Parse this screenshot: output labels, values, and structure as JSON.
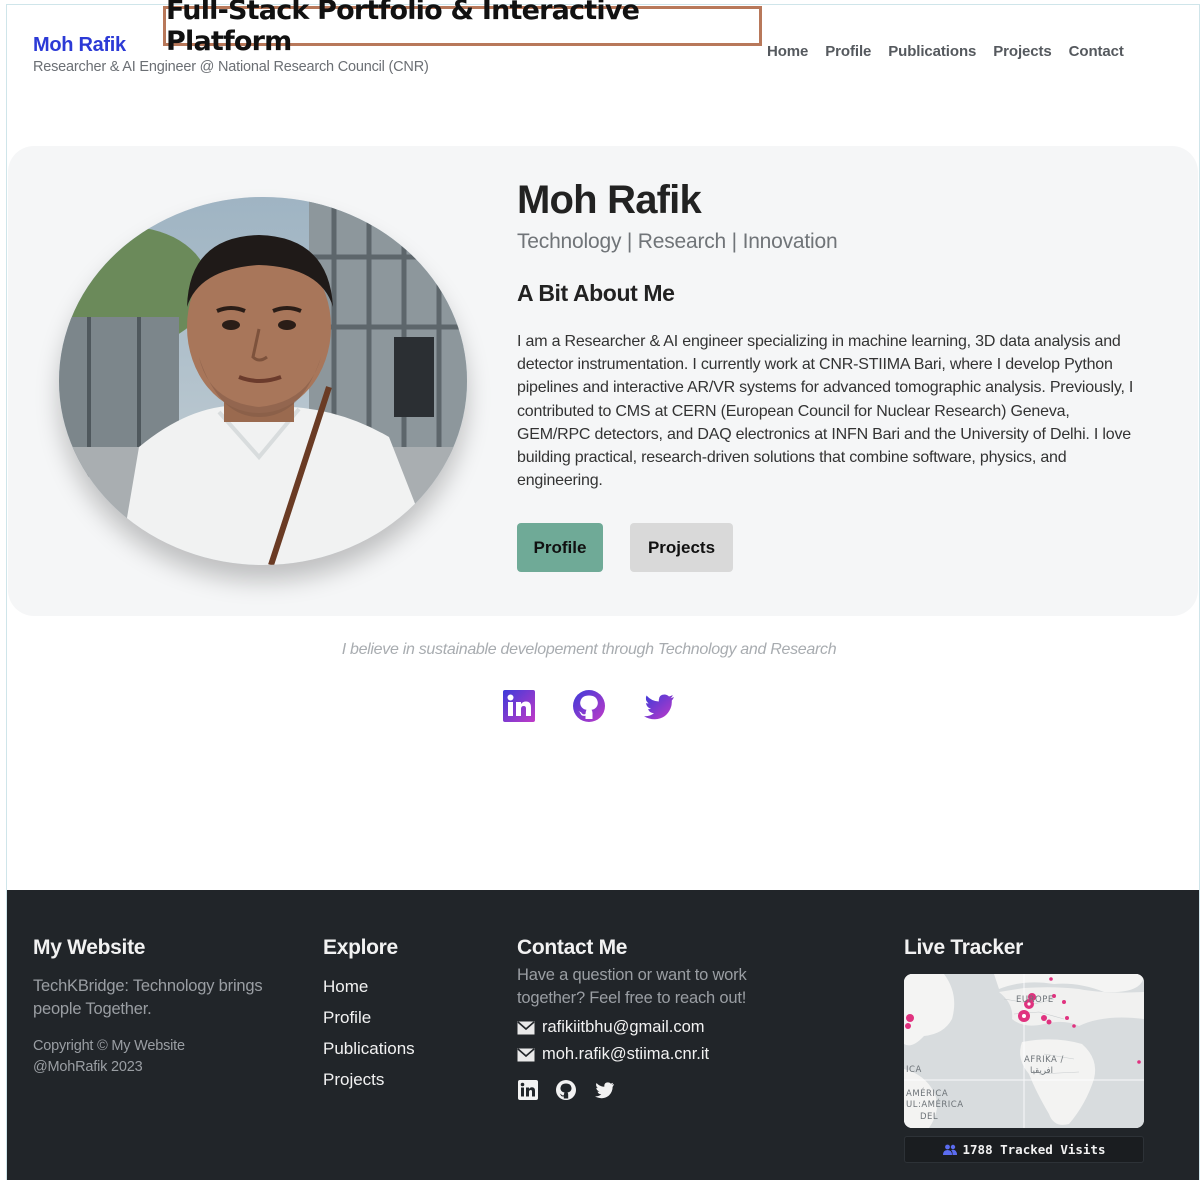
{
  "banner": {
    "title": "Full-Stack Portfolio & Interactive Platform"
  },
  "header": {
    "brand": "Moh Rafik",
    "subtitle": "Researcher & AI Engineer @ National Research Council (CNR)",
    "nav": [
      "Home",
      "Profile",
      "Publications",
      "Projects",
      "Contact"
    ]
  },
  "hero": {
    "name": "Moh Rafik",
    "tagline": "Technology | Research | Innovation",
    "about_title": "A Bit About Me",
    "about_text": "I am a Researcher & AI engineer specializing in machine learning, 3D data analysis and detector instrumentation. I currently work at CNR-STIIMA Bari, where I develop Python pipelines and interactive AR/VR systems for advanced tomographic analysis. Previously, I contributed to CMS at CERN (European Council for Nuclear Research) Geneva, GEM/RPC detectors, and DAQ electronics at INFN Bari and the University of Delhi. I love building practical, research-driven solutions that combine software, physics, and engineering.",
    "buttons": {
      "profile": "Profile",
      "projects": "Projects"
    }
  },
  "motto": "I believe in sustainable developement through Technology and Research",
  "socials": [
    "linkedin-icon",
    "github-icon",
    "twitter-icon"
  ],
  "footer": {
    "site": {
      "title": "My Website",
      "tagline": "TechKBridge: Technology brings people Together.",
      "copyright": "Copyright © My Website @MohRafik 2023"
    },
    "explore": {
      "title": "Explore",
      "links": [
        "Home",
        "Profile",
        "Publications",
        "Projects"
      ]
    },
    "contact": {
      "title": "Contact Me",
      "text": "Have a question or want to work together? Feel free to reach out!",
      "emails": [
        "rafikiitbhu@gmail.com",
        "moh.rafik@stiima.cnr.it"
      ]
    },
    "tracker": {
      "title": "Live Tracker",
      "map_labels": [
        "EUROPE",
        "AFRIKA /",
        "افريقيا",
        "ICA",
        "AMÉRICA",
        "UL:AMÉRICA",
        "DEL"
      ],
      "visits": "1788 Tracked Visits"
    }
  },
  "colors": {
    "brand_blue": "#2c3ad6",
    "profile_button": "#6faa97",
    "projects_button": "#d9d9d9",
    "footer_bg": "#212529",
    "banner_border": "#b8785a",
    "social_gradient_start": "#3d3bd9",
    "social_gradient_end": "#c13ac7"
  }
}
